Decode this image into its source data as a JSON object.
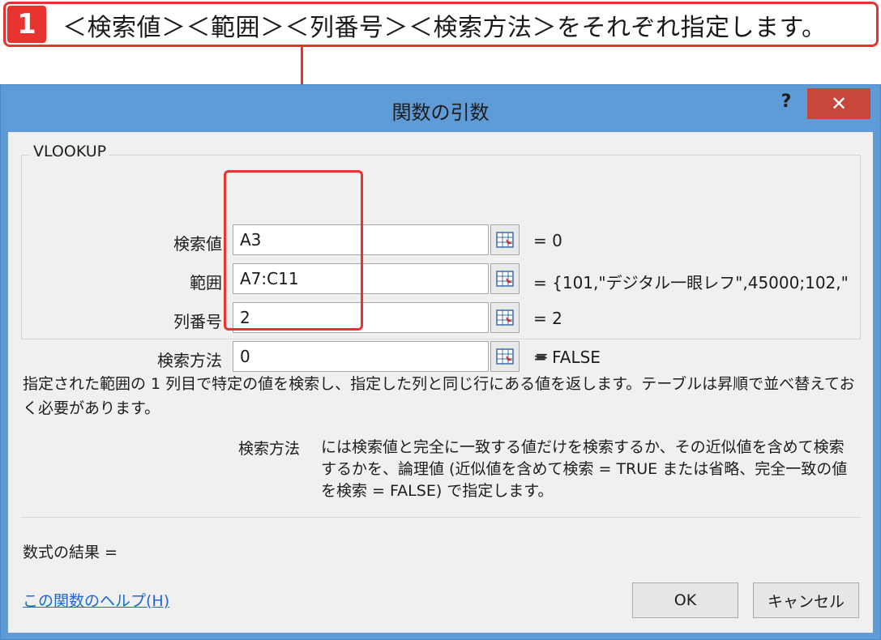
{
  "callout": {
    "number": "1",
    "text": "＜検索値＞＜範囲＞＜列番号＞＜検索方法＞をそれぞれ指定します。"
  },
  "dialog": {
    "title": "関数の引数",
    "help_button": "?",
    "close_button": "✕",
    "function_name": "VLOOKUP",
    "arguments": [
      {
        "label": "検索値",
        "value": "A3",
        "result": "=  0"
      },
      {
        "label": "範囲",
        "value": "A7:C11",
        "result": "=  {101,\"デジタル一眼レフ\",45000;102,\""
      },
      {
        "label": "列番号",
        "value": "2",
        "result": "=  2"
      },
      {
        "label": "検索方法",
        "value": "0",
        "result": "=  FALSE"
      }
    ],
    "overall_result": "=",
    "description": "指定された範囲の 1 列目で特定の値を検索し、指定した列と同じ行にある値を返します。テーブルは昇順で並べ替えておく必要があります。",
    "arg_description_label": "検索方法",
    "arg_description_text": "には検索値と完全に一致する値だけを検索するか、その近似値を含めて検索するかを、論理値 (近似値を含めて検索 = TRUE または省略、完全一致の値を検索 = FALSE) で指定します。",
    "formula_result_label": "数式の結果 =",
    "help_link": "この関数のヘルプ(H)",
    "ok_button": "OK",
    "cancel_button": "キャンセル"
  },
  "colors": {
    "accent_red": "#e8332e",
    "titlebar_blue": "#5f9bd6",
    "close_red": "#c7483b",
    "link_blue": "#2266cc"
  }
}
